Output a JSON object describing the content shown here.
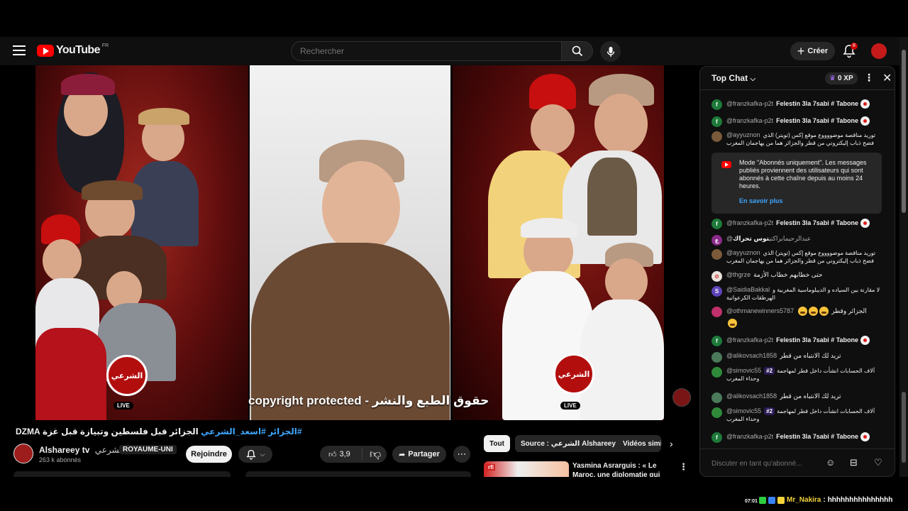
{
  "masthead": {
    "logo_text": "YouTube",
    "country_code": "FR",
    "search_placeholder": "Rechercher",
    "create_label": "Créer",
    "notification_count": "8"
  },
  "video": {
    "overlay_text": "copyright protected - حقوق الطبع والنشر",
    "title_hashtag1": "#الجزائر",
    "title_hashtag2": "#اسعد_الشرعي",
    "title_main": "الجزائر قبل فلسطين وتبيازة قبل غزة DZMA",
    "live_badge": "LIVE"
  },
  "channel": {
    "name": "Alshareey tv",
    "arabic_name": "الشرعي",
    "country_badge": "ROYAUME-UNI",
    "subscribers": "263 k abonnés",
    "join_label": "Rejoindre",
    "like_count": "3,9",
    "share_label": "Partager"
  },
  "chips": [
    {
      "label": "Tout"
    },
    {
      "label": "Source : الشرعي Alshareey tv"
    },
    {
      "label": "Vidéos simi"
    }
  ],
  "recommendation": {
    "thumb_label": "rfi",
    "title": "Yasmina Asrarguis : « Le Maroc, une diplomatie qui sait parler"
  },
  "chat": {
    "title": "Top Chat",
    "xp": "0 XP",
    "notice_text": "Mode \"Abonnés uniquement\". Les messages publiés proviennent des utilisateurs qui sont abonnés à cette chaîne depuis au moins 24 heures.",
    "notice_link": "En savoir plus",
    "input_placeholder": "Discuter en tant qu'abonné...",
    "messages": [
      {
        "author": "@franzkafka-p2t",
        "text": "Felestin 3la 7sabi # Tabone"
      },
      {
        "author": "@franzkafka-p2t",
        "text": "Felestin 3la 7sabi # Tabone"
      },
      {
        "author": "@ayyuznon",
        "text": "تورید مناقصة موضووووع موقع إكس (تويتر) الذي فضح ذباب إليكتروني من قطر والجزائر هما من يهاجمان المغرب"
      },
      {
        "author": "@franzkafka-p2t",
        "text": "Felestin 3la 7sabi # Tabone"
      },
      {
        "author": "@عبدالرحيمابراكتي",
        "text": "توس تحراك"
      },
      {
        "author": "@ayyuznon",
        "text": "تورید مناقصة موضووووع موقع إكس (تويتر) الذي فضح ذباب إليكتروني من قطر والجزائر هما من يهاجمان المغرب"
      },
      {
        "author": "@thgrze",
        "text": "حتى خطابهم خطاب الأزمة"
      },
      {
        "author": "@SaidiaBakkal",
        "text": "لا مقارنة بين السياده و الديبلوماسية المغربية و الهرطقات الكرعوانية"
      },
      {
        "author": "@othmanewinners5787",
        "text": "الجزائر وقطر"
      },
      {
        "author": "@franzkafka-p2t",
        "text": "Felestin 3la 7sabi # Tabone"
      },
      {
        "author": "@alikovsach1858",
        "text": "تريد لك الانتباه من قطر"
      },
      {
        "author": "@simovic55",
        "rank": "#2",
        "text": "آلاف الحسابات انشأت داخل قطر لمهاجمة وحداء المغرب"
      },
      {
        "author": "@alikovsach1858",
        "text": "تريد لك الانتباه من قطر"
      },
      {
        "author": "@simovic55",
        "rank": "#2",
        "text": "آلاف الحسابات انشأت داخل قطر لمهاجمة وحداء المغرب"
      },
      {
        "author": "@franzkafka-p2t",
        "text": "Felestin 3la 7sabi # Tabone"
      }
    ]
  },
  "stream_overlay": {
    "time": "07:01",
    "user": "Mr_Nakira",
    "message": "hhhhhhhhhhhhhhh"
  },
  "colors": {
    "brand_red": "#ff0000",
    "link_blue": "#3ea6ff",
    "background": "#0f0f0f"
  }
}
